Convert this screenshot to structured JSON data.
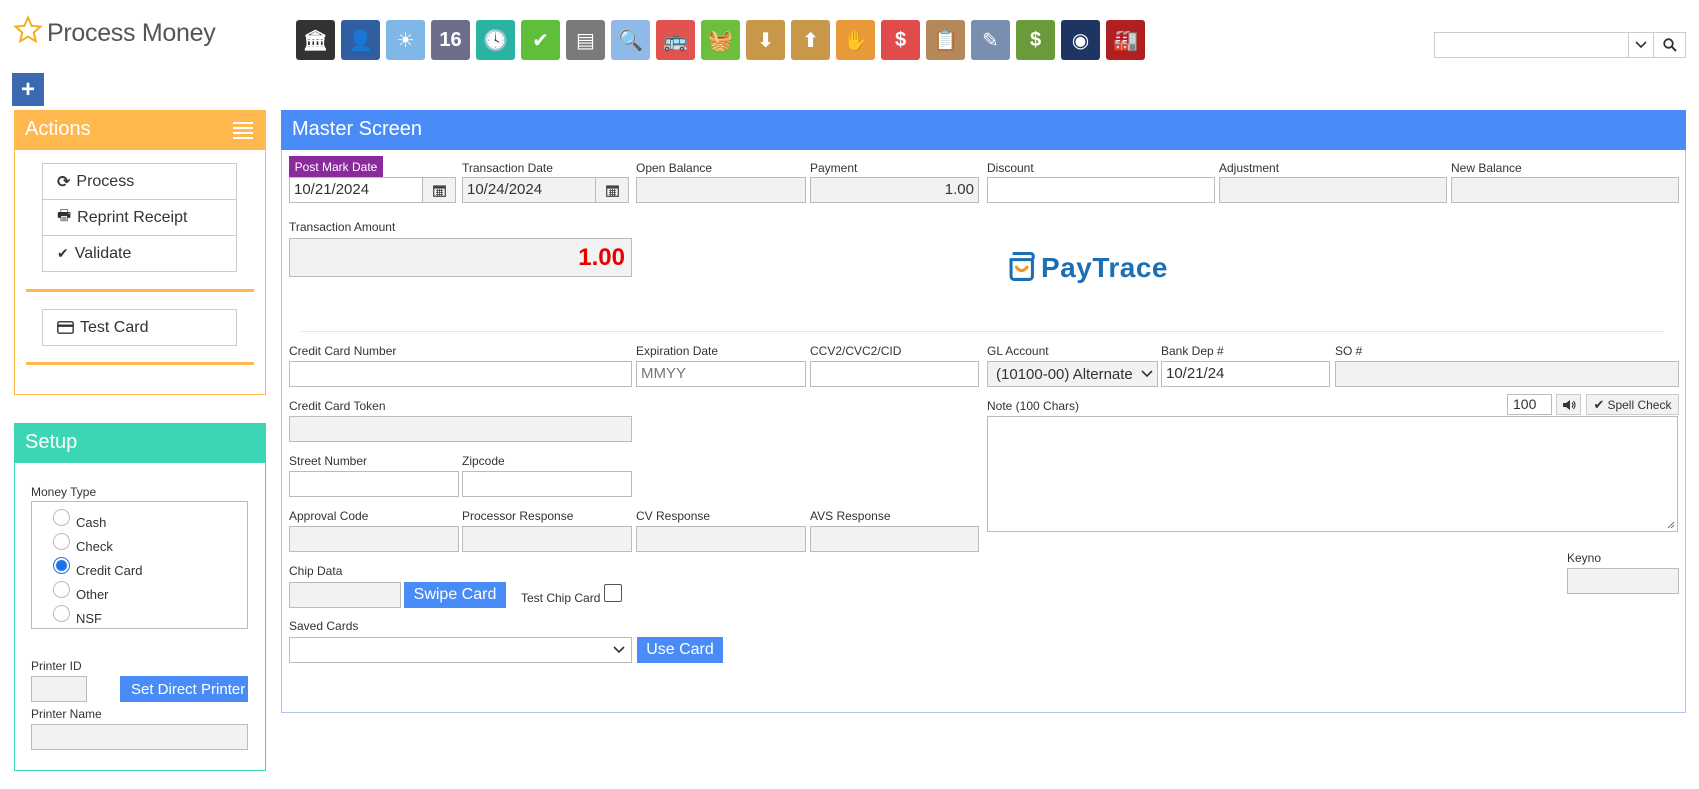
{
  "header": {
    "title": "Process Money",
    "star_icon": "star-outline-icon",
    "toolbar_icons": [
      {
        "name": "bank-icon",
        "color": "#333333",
        "glyph": "🏛"
      },
      {
        "name": "person-icon",
        "color": "#2f5fa0",
        "glyph": "👤"
      },
      {
        "name": "weather-sun-icon",
        "color": "#7fb7e6",
        "glyph": "☀"
      },
      {
        "name": "calendar-16-icon",
        "color": "#6e6e8c",
        "glyph": "16"
      },
      {
        "name": "clock-icon",
        "color": "#2ab3a3",
        "glyph": "🕓"
      },
      {
        "name": "checkmark-icon",
        "color": "#5fbf3a",
        "glyph": "✔"
      },
      {
        "name": "abacus-icon",
        "color": "#7a7a7a",
        "glyph": "▤"
      },
      {
        "name": "magnifier-icon",
        "color": "#8fb9e6",
        "glyph": "🔍"
      },
      {
        "name": "bus-icon",
        "color": "#e2524e",
        "glyph": "🚌"
      },
      {
        "name": "basket-icon",
        "color": "#6cbf3a",
        "glyph": "🧺"
      },
      {
        "name": "box-download-icon",
        "color": "#c9974a",
        "glyph": "⬇"
      },
      {
        "name": "box-upload-icon",
        "color": "#c9974a",
        "glyph": "⬆"
      },
      {
        "name": "hand-money-icon",
        "color": "#e89a3a",
        "glyph": "✋"
      },
      {
        "name": "chat-dollar-icon",
        "color": "#e24b4b",
        "glyph": "$"
      },
      {
        "name": "clipboard-icon",
        "color": "#b5885a",
        "glyph": "📋"
      },
      {
        "name": "pencil-note-icon",
        "color": "#7a8fb0",
        "glyph": "✎"
      },
      {
        "name": "money-icon",
        "color": "#6a9a3a",
        "glyph": "$"
      },
      {
        "name": "passport-icon",
        "color": "#1d3560",
        "glyph": "◉"
      },
      {
        "name": "factory-icon",
        "color": "#b02020",
        "glyph": "🏭"
      }
    ]
  },
  "search": {
    "value": "",
    "dropdown_icon": "chevron-down-icon",
    "search_icon": "search-icon"
  },
  "add_button": "+",
  "actions": {
    "title": "Actions",
    "menu_icon": "hamburger-menu-icon",
    "buttons": [
      {
        "label": "Process",
        "icon": "refresh-icon",
        "glyph": "⟳"
      },
      {
        "label": "Reprint Receipt",
        "icon": "printer-icon",
        "glyph": "🖶"
      },
      {
        "label": "Validate",
        "icon": "check-icon",
        "glyph": "✔"
      }
    ],
    "test_card": {
      "label": "Test Card",
      "icon": "credit-card-icon",
      "glyph": "▭"
    }
  },
  "setup": {
    "title": "Setup",
    "money_type_label": "Money Type",
    "money_types": [
      {
        "label": "Cash",
        "checked": false
      },
      {
        "label": "Check",
        "checked": false
      },
      {
        "label": "Credit Card",
        "checked": true
      },
      {
        "label": "Other",
        "checked": false
      },
      {
        "label": "NSF",
        "checked": false
      }
    ],
    "printer_id_label": "Printer ID",
    "printer_id_value": "",
    "set_direct_printer": "Set Direct Printer",
    "printer_name_label": "Printer Name",
    "printer_name_value": ""
  },
  "master": {
    "title": "Master Screen",
    "post_mark_date_label": "Post Mark Date",
    "post_mark_date": "10/21/2024",
    "transaction_date_label": "Transaction Date",
    "transaction_date": "10/24/2024",
    "open_balance_label": "Open Balance",
    "open_balance": "",
    "payment_label": "Payment",
    "payment": "1.00",
    "discount_label": "Discount",
    "discount": "",
    "adjustment_label": "Adjustment",
    "adjustment": "",
    "new_balance_label": "New Balance",
    "new_balance": "",
    "transaction_amount_label": "Transaction Amount",
    "transaction_amount": "1.00",
    "logo_text": "PayTrace",
    "logo_color": "#1a6fb5",
    "logo_accent": "#f2951c",
    "credit_card_number_label": "Credit Card Number",
    "credit_card_number": "",
    "expiration_date_label": "Expiration Date",
    "expiration_placeholder": "MMYY",
    "ccv_label": "CCV2/CVC2/CID",
    "ccv": "",
    "gl_account_label": "GL Account",
    "gl_account": "(10100-00) Alternate",
    "bank_dep_label": "Bank Dep #",
    "bank_dep": "10/21/24",
    "so_label": "SO #",
    "so": "",
    "credit_card_token_label": "Credit Card Token",
    "credit_card_token": "",
    "note_label": "Note (100 Chars)",
    "note_count": "100",
    "speaker_icon": "speaker-icon",
    "spell_check": "Spell Check",
    "street_number_label": "Street Number",
    "street_number": "",
    "zipcode_label": "Zipcode",
    "zipcode": "",
    "approval_code_label": "Approval Code",
    "processor_response_label": "Processor Response",
    "cv_response_label": "CV Response",
    "avs_response_label": "AVS Response",
    "chip_data_label": "Chip Data",
    "swipe_card": "Swipe Card",
    "test_chip_card_label": "Test Chip Card",
    "keyno_label": "Keyno",
    "keyno": "",
    "saved_cards_label": "Saved Cards",
    "saved_cards_value": "",
    "use_card": "Use Card",
    "calendar_icon": "calendar-icon"
  },
  "colors": {
    "actions_accent": "#ffb84d",
    "setup_accent": "#3dd6b4",
    "master_accent": "#4a8cf7",
    "post_mark_badge": "#8b2a9c",
    "amount_red": "#e60000"
  }
}
